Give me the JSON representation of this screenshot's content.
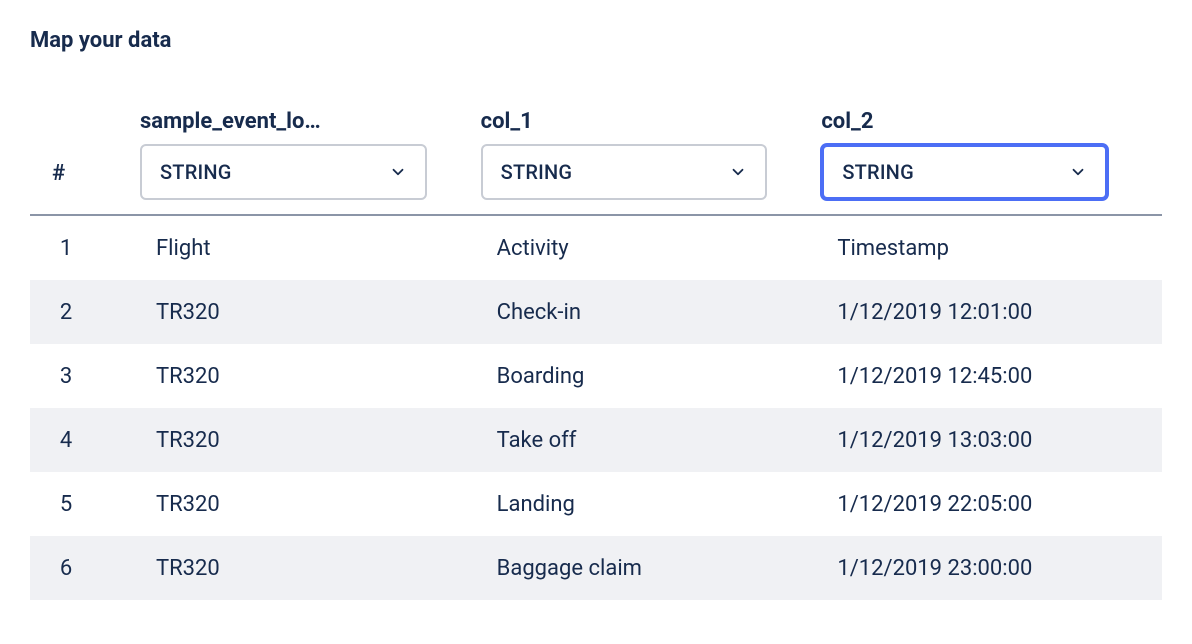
{
  "page_title": "Map your data",
  "hash_label": "#",
  "columns": [
    {
      "name": "sample_event_lo…",
      "type": "STRING",
      "focused": false
    },
    {
      "name": "col_1",
      "type": "STRING",
      "focused": false
    },
    {
      "name": "col_2",
      "type": "STRING",
      "focused": true
    }
  ],
  "rows": [
    {
      "n": "1",
      "c": [
        "Flight",
        "Activity",
        "Timestamp"
      ]
    },
    {
      "n": "2",
      "c": [
        "TR320",
        "Check-in",
        "1/12/2019 12:01:00"
      ]
    },
    {
      "n": "3",
      "c": [
        "TR320",
        "Boarding",
        "1/12/2019 12:45:00"
      ]
    },
    {
      "n": "4",
      "c": [
        "TR320",
        "Take off",
        "1/12/2019 13:03:00"
      ]
    },
    {
      "n": "5",
      "c": [
        "TR320",
        "Landing",
        "1/12/2019 22:05:00"
      ]
    },
    {
      "n": "6",
      "c": [
        "TR320",
        "Baggage claim",
        "1/12/2019 23:00:00"
      ]
    }
  ]
}
